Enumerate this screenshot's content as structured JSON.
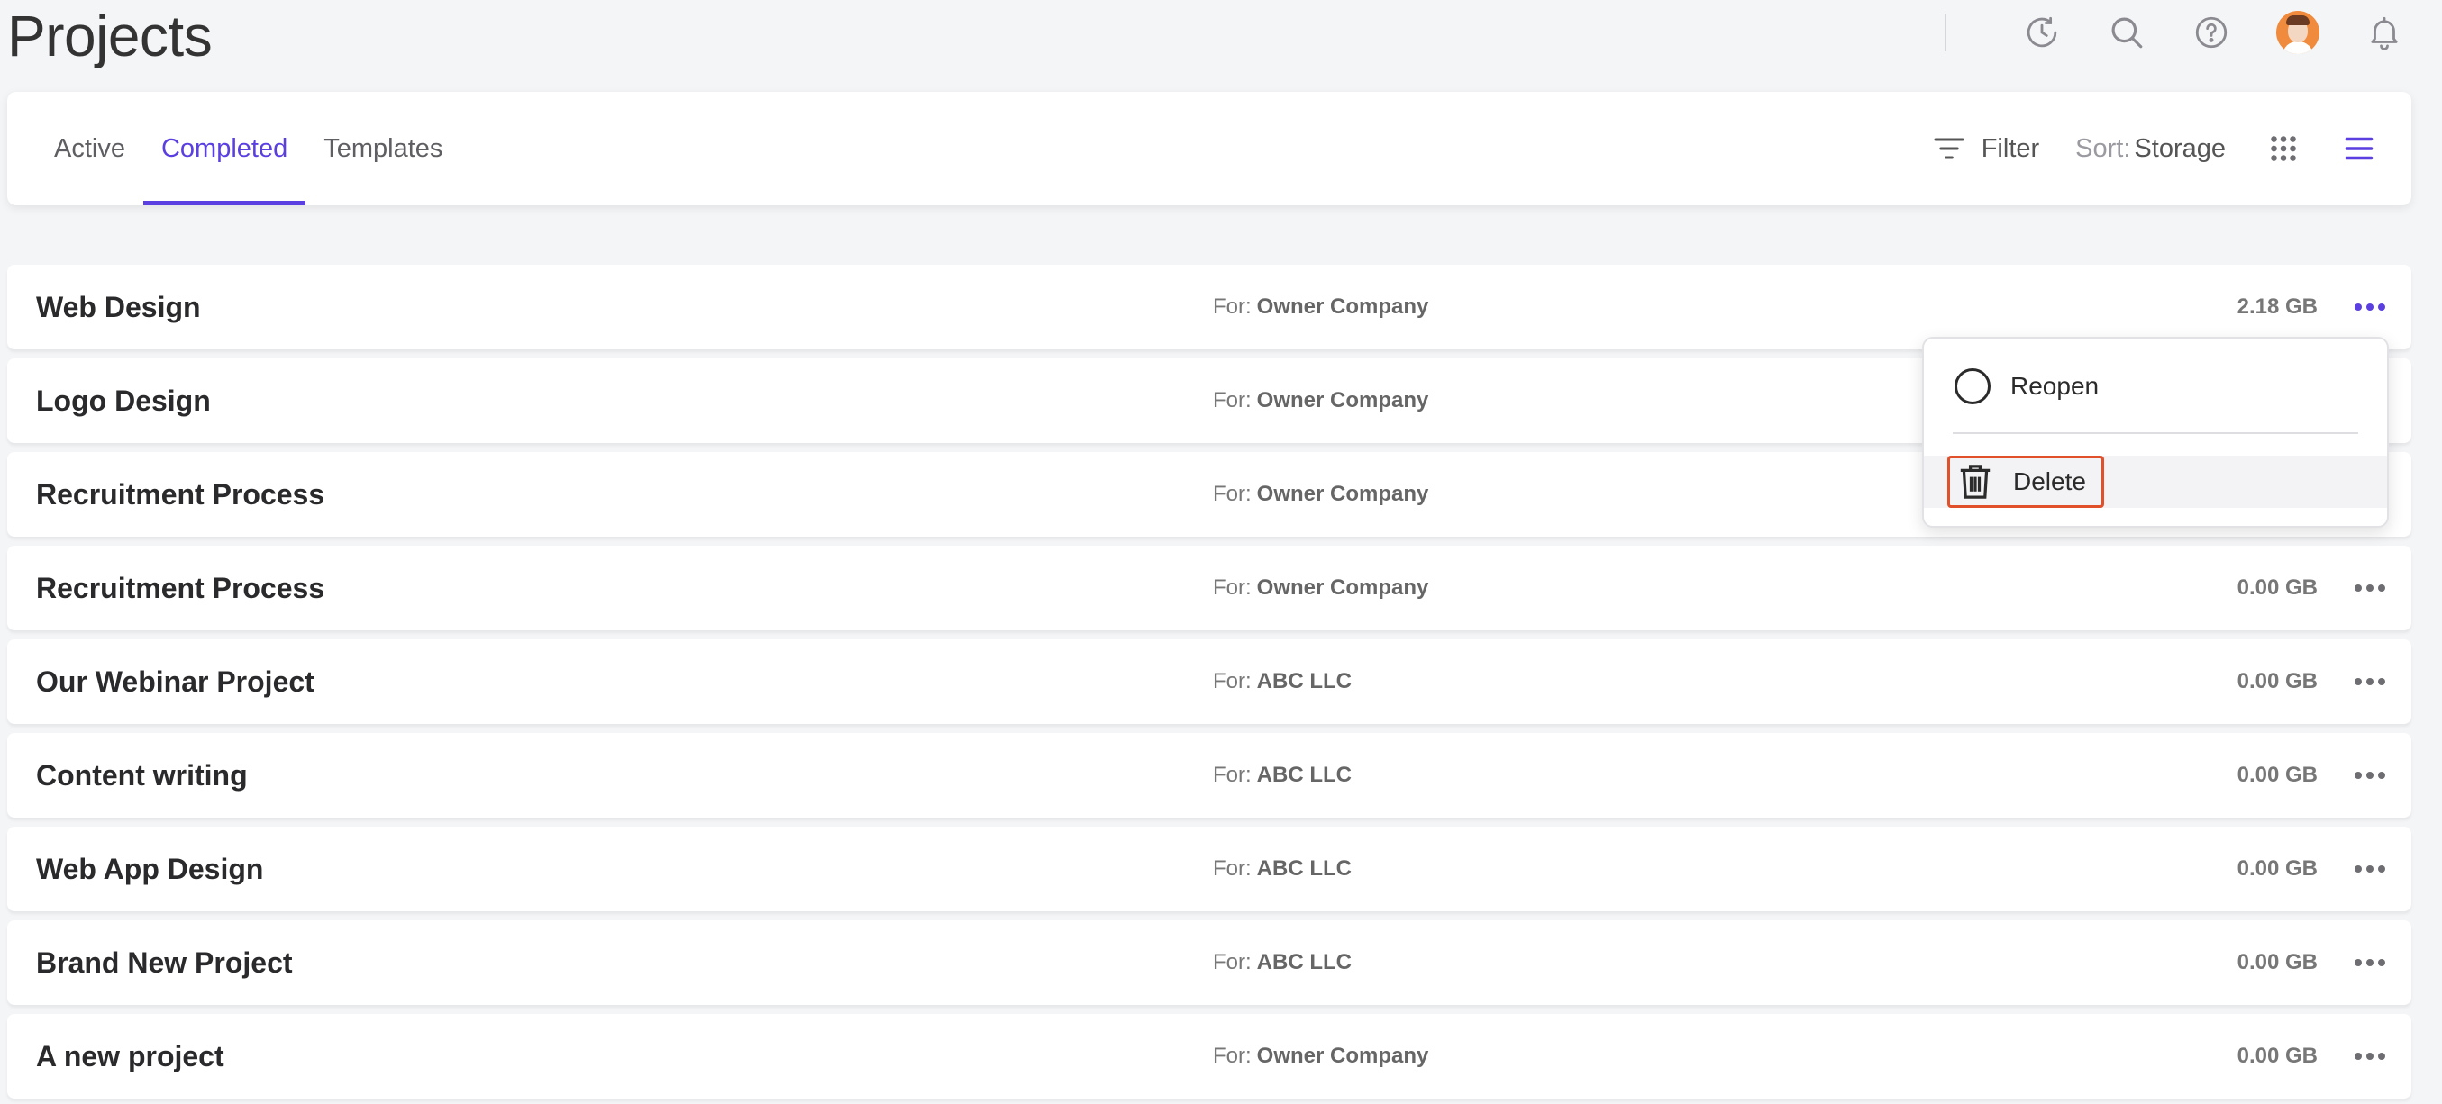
{
  "header": {
    "title": "Projects",
    "icons": [
      "clock-icon",
      "search-icon",
      "help-icon",
      "avatar",
      "bell-icon"
    ]
  },
  "toolbar": {
    "tabs": [
      {
        "label": "Active",
        "active": false
      },
      {
        "label": "Completed",
        "active": true
      },
      {
        "label": "Templates",
        "active": false
      }
    ],
    "filter_label": "Filter",
    "sort_prefix": "Sort:",
    "sort_value": "Storage",
    "active_view": "list"
  },
  "colors": {
    "accent": "#5b3fe0",
    "highlight_border": "#e0502a",
    "background": "#f4f5f7"
  },
  "projects": [
    {
      "name": "Web Design",
      "for_label": "For:",
      "client": "Owner Company",
      "size": "2.18 GB"
    },
    {
      "name": "Logo Design",
      "for_label": "For:",
      "client": "Owner Company",
      "size": ""
    },
    {
      "name": "Recruitment Process",
      "for_label": "For:",
      "client": "Owner Company",
      "size": ""
    },
    {
      "name": "Recruitment Process",
      "for_label": "For:",
      "client": "Owner Company",
      "size": "0.00 GB"
    },
    {
      "name": "Our Webinar Project",
      "for_label": "For:",
      "client": "ABC LLC",
      "size": "0.00 GB"
    },
    {
      "name": "Content writing",
      "for_label": "For:",
      "client": "ABC LLC",
      "size": "0.00 GB"
    },
    {
      "name": "Web App Design",
      "for_label": "For:",
      "client": "ABC LLC",
      "size": "0.00 GB"
    },
    {
      "name": "Brand New Project",
      "for_label": "For:",
      "client": "ABC LLC",
      "size": "0.00 GB"
    },
    {
      "name": "A new project",
      "for_label": "For:",
      "client": "Owner Company",
      "size": "0.00 GB"
    }
  ],
  "context_menu": {
    "reopen_label": "Reopen",
    "delete_label": "Delete"
  }
}
